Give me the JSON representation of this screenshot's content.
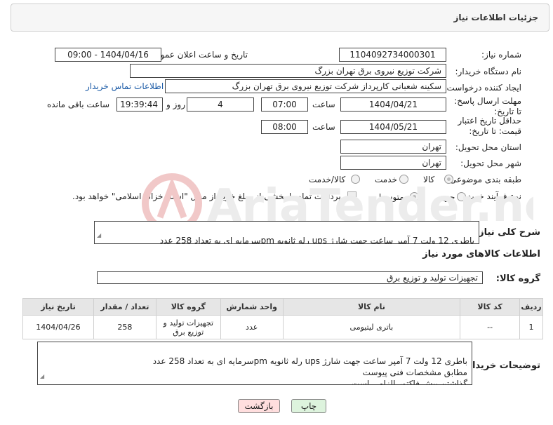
{
  "panel": {
    "title": "جزئیات اطلاعات نیاز"
  },
  "fields": {
    "need_number_label": "شماره نیاز:",
    "need_number": "1104092734000301",
    "announce_label": "تاریخ و ساعت اعلان عمومی:",
    "announce_value": "1404/04/16 - 09:00",
    "buyer_org_label": "نام دستگاه خریدار:",
    "buyer_org": "شرکت توزیع نیروی برق تهران بزرگ",
    "creator_label": "ایجاد کننده درخواست:",
    "creator": "سکینه شعبانی کارپرداز شرکت توزیع نیروی برق تهران بزرگ",
    "contact_link": "اطلاعات تماس خریدار",
    "deadline_label": "مهلت ارسال پاسخ: تا تاریخ:",
    "deadline_date": "1404/04/21",
    "hour_label": "ساعت",
    "deadline_time": "07:00",
    "days_value": "4",
    "days_label": "روز و",
    "remaining_time": "19:39:44",
    "remaining_label": "ساعت باقی مانده",
    "price_validity_label": "حداقل تاریخ اعتبار قیمت: تا تاریخ:",
    "price_validity_date": "1404/05/21",
    "price_validity_time": "08:00",
    "province_label": "استان محل تحویل:",
    "province": "تهران",
    "city_label": "شهر محل تحویل:",
    "city": "تهران",
    "category_label": "طبقه بندی موضوعی:",
    "category_options": [
      "کالا",
      "خدمت",
      "کالا/خدمت"
    ],
    "process_label": "نوع فرآیند خرید :",
    "process_options": [
      "جزیی",
      "متوسط"
    ],
    "payment_note": "پرداخت تمام یا بخشی از مبلغ خرید،از محل \"اسناد خزانه اسلامی\" خواهد بود."
  },
  "description": {
    "label": "شرح کلی نیاز:",
    "text": "باطری 12 ولت 7 آمپر ساعت جهت شارژ ups رله ثانویه pmسرمایه ای به تعداد 258 عدد"
  },
  "goods_section": {
    "title": "اطلاعات کالاهای مورد نیاز",
    "group_label": "گروه کالا:",
    "group_value": "تجهیزات تولید و توزیع برق"
  },
  "table": {
    "headers": [
      "ردیف",
      "کد کالا",
      "نام کالا",
      "واحد شمارش",
      "گروه کالا",
      "تعداد / مقدار",
      "تاریخ نیاز"
    ],
    "rows": [
      [
        "1",
        "--",
        "باتری لیتیومی",
        "عدد",
        "تجهیزات تولید و توزیع برق",
        "258",
        "1404/04/26"
      ]
    ]
  },
  "buyer_notes": {
    "label": "توضیحات خریدار:",
    "text": "باطری 12 ولت 7 آمپر ساعت جهت شارژ ups رله ثانویه pmسرمایه ای به تعداد 258 عدد\nمطابق مشخصات فنی پیوست\nگذاشتن پیش فاکتور الزامی است"
  },
  "buttons": {
    "print": "چاپ",
    "back": "بازگشت"
  },
  "watermark": {
    "text": "AriaTender.net"
  }
}
